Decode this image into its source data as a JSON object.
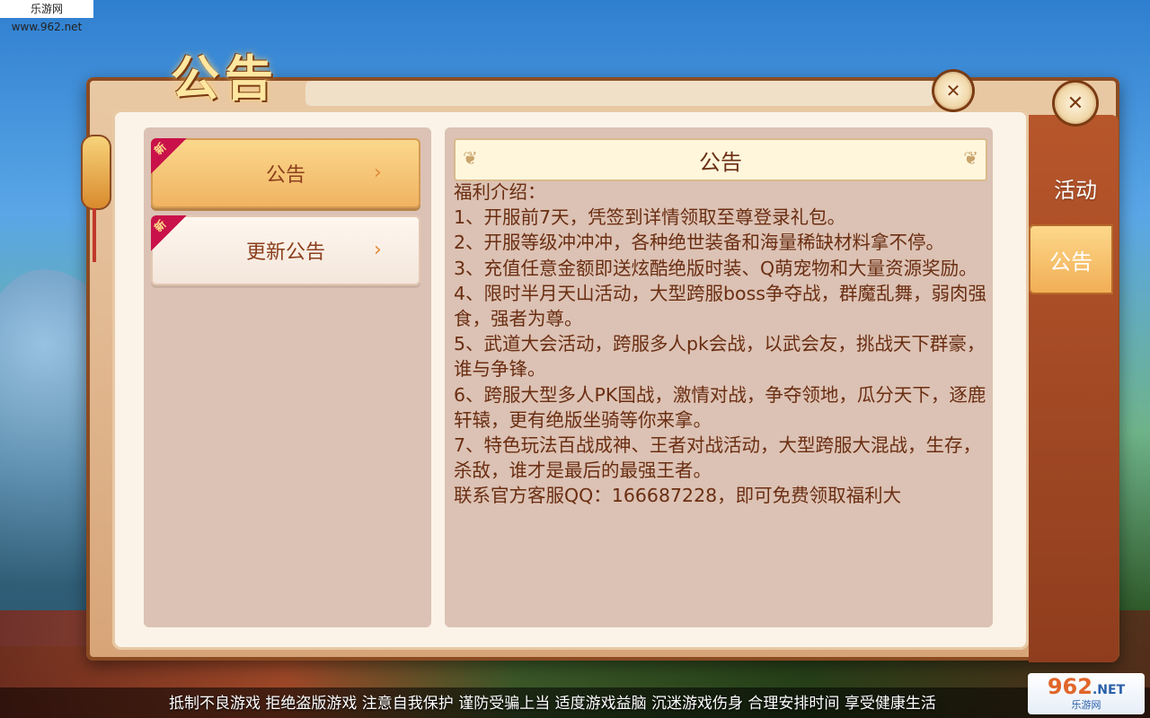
{
  "watermark": {
    "top_left": "乐游网 www.962.net"
  },
  "window": {
    "title_logo": "公告"
  },
  "left_tabs": [
    {
      "label": "公告",
      "badge": "新"
    },
    {
      "label": "更新公告",
      "badge": "新"
    }
  ],
  "content": {
    "title": "公告",
    "body": "福利介绍：\n1、开服前7天，凭签到详情领取至尊登录礼包。\n2、开服等级冲冲冲，各种绝世装备和海量稀缺材料拿不停。\n3、充值任意金额即送炫酷绝版时装、Q萌宠物和大量资源奖励。\n4、限时半月天山活动，大型跨服boss争夺战，群魔乱舞，弱肉强食，强者为尊。\n5、武道大会活动，跨服多人pk会战，以武会友，挑战天下群豪，谁与争锋。\n6、跨服大型多人PK国战，激情对战，争夺领地，瓜分天下，逐鹿轩辕，更有绝版坐骑等你来拿。\n7、特色玩法百战成神、王者对战活动，大型跨服大混战，生存，杀敌，谁才是最后的最强王者。\n联系官方客服QQ：166687228，即可免费领取福利大"
  },
  "side_tabs": [
    {
      "label": "活动"
    },
    {
      "label": "公告"
    }
  ],
  "footer": {
    "notice": "抵制不良游戏 拒绝盗版游戏 注意自我保护 谨防受骗上当 适度游戏益脑 沉迷游戏伤身 合理安排时间 享受健康生活"
  },
  "brand_logo": {
    "number": "962",
    "suffix": ".NET",
    "cn": "乐游网"
  }
}
